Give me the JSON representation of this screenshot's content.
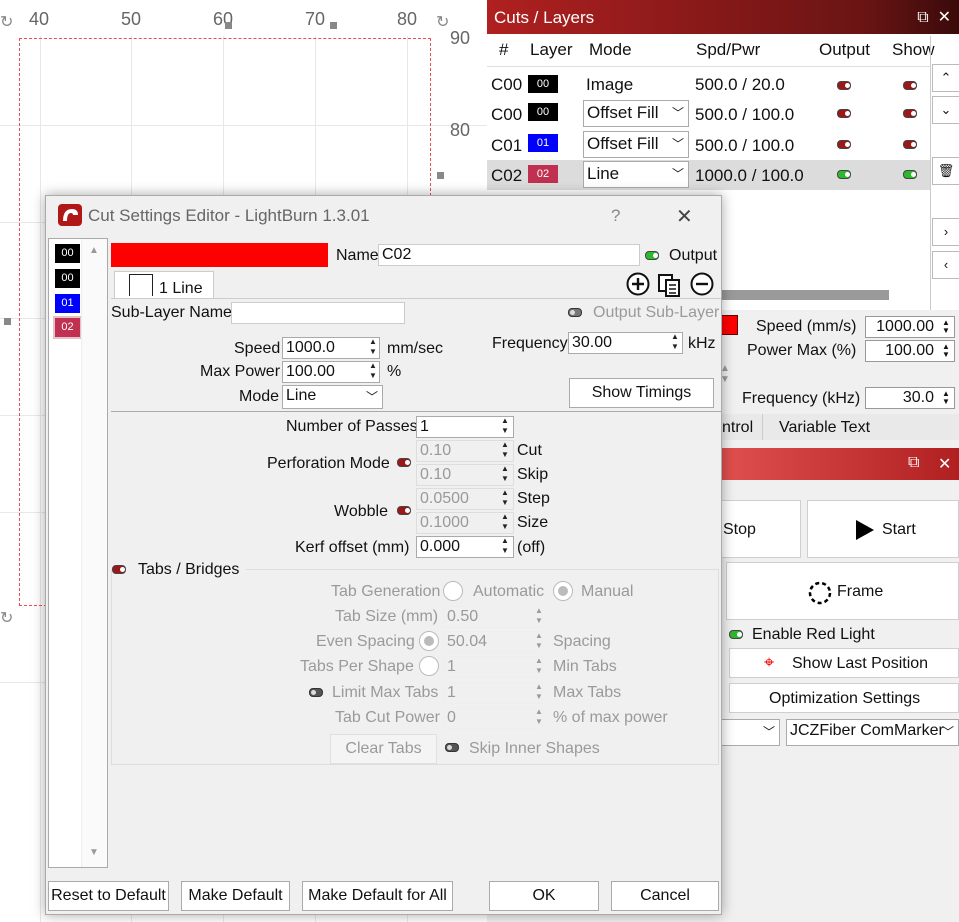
{
  "canvas": {
    "ruler_top": [
      "40",
      "50",
      "60",
      "70",
      "80"
    ],
    "ruler_right": [
      "90",
      "80"
    ]
  },
  "cuts_panel": {
    "title": "Cuts / Layers",
    "columns": [
      "#",
      "Layer",
      "Mode",
      "Spd/Pwr",
      "Output",
      "Show"
    ],
    "rows": [
      {
        "num": "C00",
        "layer": "00",
        "color": "#000000",
        "mode": "Image",
        "spd_pwr": "500.0 / 20.0",
        "output": false,
        "show": false,
        "combo": false
      },
      {
        "num": "C00",
        "layer": "00",
        "color": "#000000",
        "mode": "Offset Fill",
        "spd_pwr": "500.0 / 100.0",
        "output": false,
        "show": false,
        "combo": true
      },
      {
        "num": "C01",
        "layer": "01",
        "color": "#0000ff",
        "mode": "Offset Fill",
        "spd_pwr": "500.0 / 100.0",
        "output": false,
        "show": false,
        "combo": true
      },
      {
        "num": "C02",
        "layer": "02",
        "color": "#c03050",
        "mode": "Line",
        "spd_pwr": "1000.0 / 100.0",
        "output": true,
        "show": true,
        "combo": true
      }
    ]
  },
  "right_panel": {
    "speed_label": "Speed (mm/s)",
    "speed_value": "1000.00",
    "power_label": "Power Max (%)",
    "power_value": "100.00",
    "freq_label": "Frequency (kHz)",
    "freq_value": "30.0",
    "tab_control": "ntrol",
    "tab_variable": "Variable Text",
    "stop_label": "Stop",
    "start_label": "Start",
    "frame_label": "Frame",
    "red_light_label": "Enable Red Light",
    "last_pos_label": "Show Last Position",
    "opt_label": "Optimization Settings",
    "device": "JCZFiber ComMarker"
  },
  "dialog": {
    "title": "Cut Settings Editor - LightBurn 1.3.01",
    "help": "?",
    "layers": [
      {
        "id": "00",
        "color": "#000000"
      },
      {
        "id": "00",
        "color": "#000000"
      },
      {
        "id": "01",
        "color": "#0000ff"
      },
      {
        "id": "02",
        "color": "#c03050"
      }
    ],
    "color": "#ff0000",
    "name_label": "Name",
    "name_value": "C02",
    "output_label": "Output",
    "sublayer_tab": "1 Line",
    "sublayer_name_label": "Sub-Layer Name",
    "sublayer_name_value": "",
    "output_sublayer_label": "Output Sub-Layer",
    "speed_label": "Speed",
    "speed_value": "1000.0",
    "speed_unit": "mm/sec",
    "maxpower_label": "Max Power",
    "maxpower_value": "100.00",
    "maxpower_unit": "%",
    "mode_label": "Mode",
    "mode_value": "Line",
    "freq_label": "Frequency",
    "freq_value": "30.00",
    "freq_unit": "kHz",
    "show_timings": "Show Timings",
    "passes_label": "Number of Passes",
    "passes_value": "1",
    "perforation_label": "Perforation Mode",
    "perf_cut": "0.10",
    "perf_cut_lbl": "Cut",
    "perf_skip": "0.10",
    "perf_skip_lbl": "Skip",
    "wobble_label": "Wobble",
    "wobble_step": "0.0500",
    "wobble_step_lbl": "Step",
    "wobble_size": "0.1000",
    "wobble_size_lbl": "Size",
    "kerf_label": "Kerf offset (mm)",
    "kerf_value": "0.000",
    "kerf_off": "(off)",
    "tabs_label": "Tabs / Bridges",
    "tab_gen_label": "Tab Generation",
    "tab_auto": "Automatic",
    "tab_manual": "Manual",
    "tab_size_label": "Tab Size (mm)",
    "tab_size_value": "0.50",
    "even_spacing_label": "Even Spacing",
    "even_spacing_value": "50.04",
    "spacing_lbl": "Spacing",
    "tabs_per_shape_label": "Tabs Per Shape",
    "tabs_per_shape_value": "1",
    "min_tabs_lbl": "Min Tabs",
    "limit_max_label": "Limit Max Tabs",
    "limit_max_value": "1",
    "max_tabs_lbl": "Max Tabs",
    "tab_cut_power_label": "Tab Cut Power",
    "tab_cut_power_value": "0",
    "pct_max_lbl": "% of max power",
    "clear_tabs": "Clear Tabs",
    "skip_inner": "Skip Inner Shapes",
    "reset": "Reset to Default",
    "make_default": "Make Default",
    "make_default_all": "Make Default for All",
    "ok": "OK",
    "cancel": "Cancel"
  }
}
